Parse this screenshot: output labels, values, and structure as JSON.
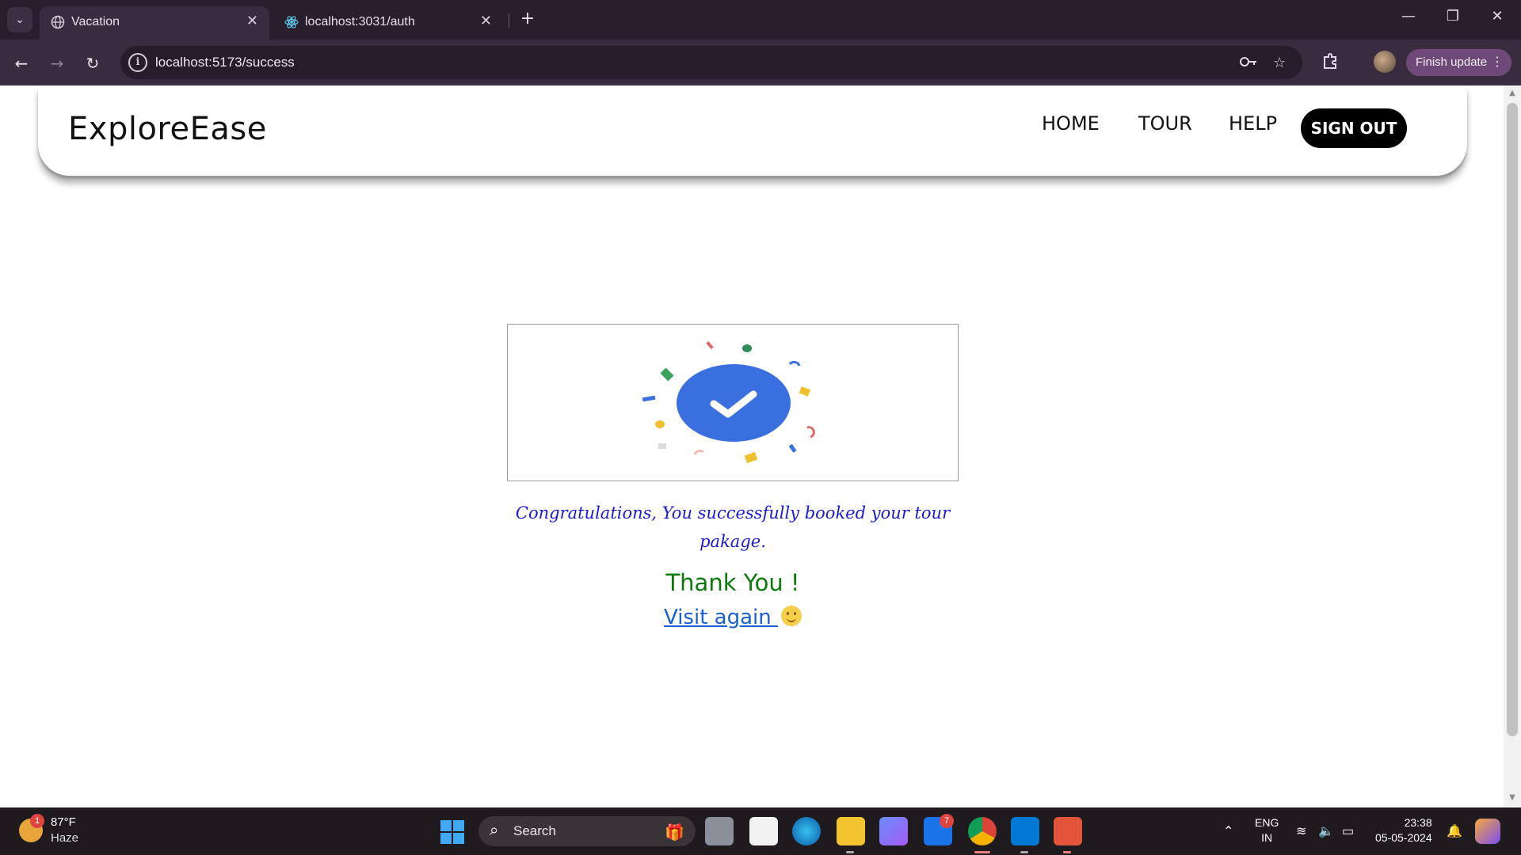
{
  "browser": {
    "tabs": [
      {
        "title": "Vacation",
        "active": true,
        "icon": "globe-icon"
      },
      {
        "title": "localhost:3031/auth",
        "active": false,
        "icon": "react-icon"
      }
    ],
    "url": "localhost:5173/success",
    "finish_update_label": "Finish update"
  },
  "site": {
    "brand": "ExploreEase",
    "nav": {
      "home": "HOME",
      "tour": "TOUR",
      "help": "HELP",
      "signout": "SIGN OUT"
    }
  },
  "success": {
    "message": "Congratulations, You successfully booked your tour pakage.",
    "thank_you": "Thank You !",
    "visit_again": "Visit again ",
    "accent": "#3a6fe0"
  },
  "taskbar": {
    "weather_temp": "87°F",
    "weather_condition": "Haze",
    "weather_badge": "1",
    "search_label": "Search",
    "mail_badge": "7",
    "lang_line1": "ENG",
    "lang_line2": "IN",
    "time": "23:38",
    "date": "05-05-2024"
  }
}
